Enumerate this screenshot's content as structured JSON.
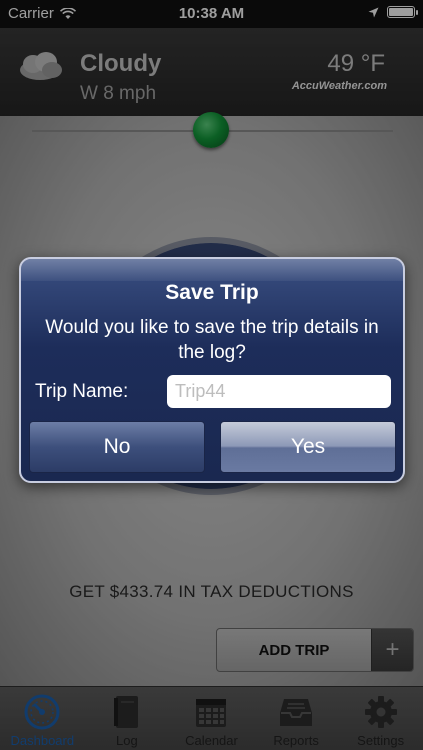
{
  "status_bar": {
    "carrier": "Carrier",
    "time": "10:38 AM"
  },
  "weather": {
    "condition": "Cloudy",
    "wind": "W 8 mph",
    "temperature": "49 °F",
    "provider": "AccuWeather.com"
  },
  "dashboard": {
    "tax_deduction_text": "GET $433.74 IN TAX DEDUCTIONS",
    "add_trip_label": "ADD TRIP",
    "add_trip_plus": "+"
  },
  "dialog": {
    "title": "Save Trip",
    "message": "Would you like to save the trip details in the log?",
    "trip_name_label": "Trip Name:",
    "trip_name_value": "",
    "trip_name_placeholder": "Trip44",
    "no_label": "No",
    "yes_label": "Yes"
  },
  "tabs": [
    {
      "label": "Dashboard",
      "icon": "speedometer-icon",
      "active": true
    },
    {
      "label": "Log",
      "icon": "book-icon",
      "active": false
    },
    {
      "label": "Calendar",
      "icon": "calendar-icon",
      "active": false
    },
    {
      "label": "Reports",
      "icon": "inbox-tray-icon",
      "active": false
    },
    {
      "label": "Settings",
      "icon": "gear-icon",
      "active": false
    }
  ],
  "colors": {
    "accent": "#1c62b0",
    "toggle_green": "#139a3b",
    "dialog_blue": "#1d2d5a"
  }
}
